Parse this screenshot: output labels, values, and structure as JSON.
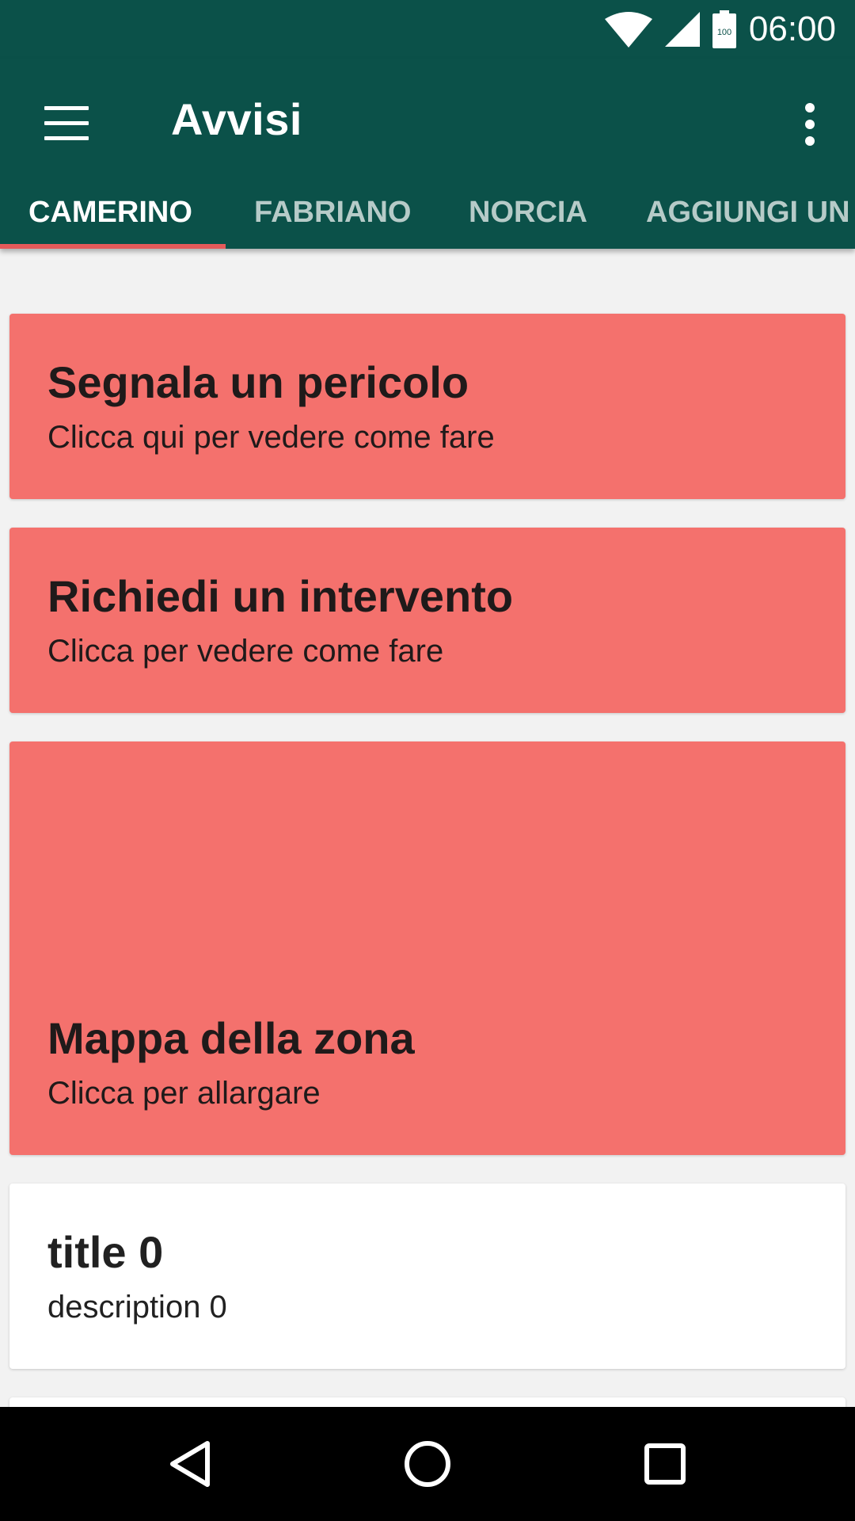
{
  "status_bar": {
    "time": "06:00",
    "battery_label": "100"
  },
  "app_bar": {
    "title": "Avvisi"
  },
  "tabs": [
    {
      "label": "CAMERINO",
      "active": true
    },
    {
      "label": "FABRIANO",
      "active": false
    },
    {
      "label": "NORCIA",
      "active": false
    },
    {
      "label": "AGGIUNGI UN",
      "active": false
    }
  ],
  "cards": [
    {
      "title": "Segnala un pericolo",
      "subtitle": "Clicca qui per vedere come fare",
      "color": "#f4716d"
    },
    {
      "title": "Richiedi un intervento",
      "subtitle": "Clicca per vedere come fare",
      "color": "#f4716d"
    },
    {
      "title": "Mappa della zona",
      "subtitle": "Clicca per allargare",
      "color": "#f4716d"
    },
    {
      "title": "title 0",
      "subtitle": "description 0",
      "color": "#ffffff"
    }
  ],
  "colors": {
    "primary": "#0b5149",
    "accent": "#e55a5a",
    "card_alert": "#f4716d",
    "background": "#f2f2f2"
  },
  "icons": {
    "menu": "hamburger-menu-icon",
    "overflow": "more-vert-icon",
    "wifi": "wifi-icon",
    "signal": "cell-signal-icon",
    "battery": "battery-icon",
    "back": "back-triangle-icon",
    "home": "home-circle-icon",
    "recents": "recents-square-icon"
  }
}
